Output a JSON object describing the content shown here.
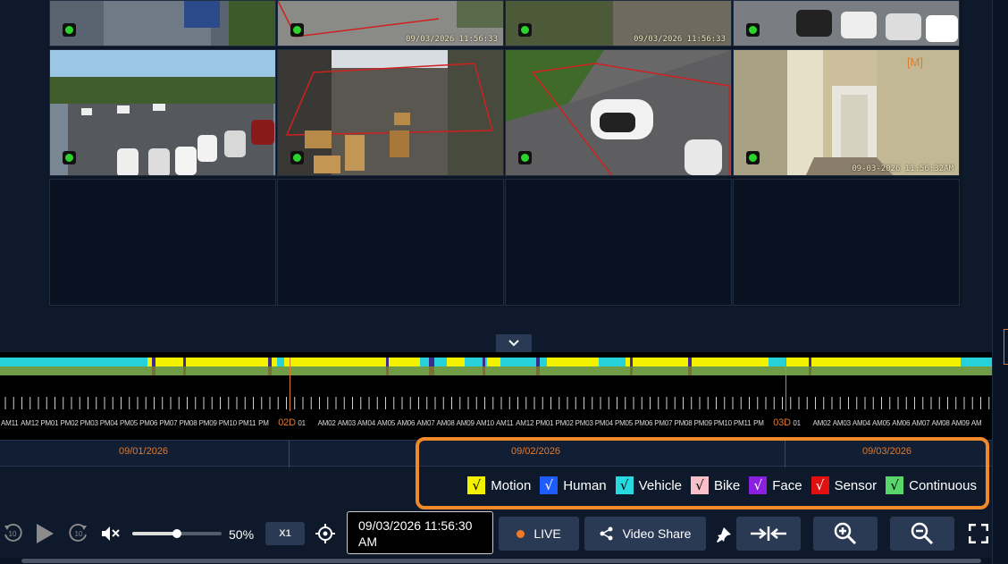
{
  "cameras": [
    {
      "id": "cam-1",
      "status": "online",
      "timestamp": ""
    },
    {
      "id": "cam-2",
      "status": "online",
      "timestamp": "09/03/2026 11:56:33"
    },
    {
      "id": "cam-3",
      "status": "online",
      "timestamp": "09/03/2026 11:56:33"
    },
    {
      "id": "cam-4",
      "status": "online",
      "timestamp": ""
    },
    {
      "id": "cam-5",
      "status": "online",
      "timestamp": ""
    },
    {
      "id": "cam-6",
      "status": "online",
      "timestamp": ""
    },
    {
      "id": "cam-7",
      "status": "online",
      "timestamp": ""
    },
    {
      "id": "cam-8",
      "status": "online",
      "timestamp": "09-03-2026 11:56:32AM",
      "mark": "[M]"
    }
  ],
  "timeline": {
    "hour_labels": [
      "AM11",
      "AM12",
      "PM01",
      "PM02",
      "PM03",
      "PM04",
      "PM05",
      "PM06",
      "PM07",
      "PM08",
      "PM09",
      "PM10",
      "PM11",
      "PM",
      "02D",
      "01",
      "AM02",
      "AM03",
      "AM04",
      "AM05",
      "AM06",
      "AM07",
      "AM08",
      "AM09",
      "AM10",
      "AM11",
      "AM12",
      "PM01",
      "PM02",
      "PM03",
      "PM04",
      "PM05",
      "PM06",
      "PM07",
      "PM08",
      "PM09",
      "PM10",
      "PM11",
      "PM",
      "03D",
      "01",
      "AM02",
      "AM03",
      "AM04",
      "AM05",
      "AM06",
      "AM07",
      "AM08",
      "AM09",
      "AM"
    ],
    "day_markers": [
      "02D",
      "03D"
    ],
    "dates": [
      "09/01/2026",
      "09/02/2026",
      "09/03/2026"
    ]
  },
  "legend": [
    {
      "label": "Motion",
      "color": "#f2f200"
    },
    {
      "label": "Human",
      "color": "#1f5cff"
    },
    {
      "label": "Vehicle",
      "color": "#27d9e0"
    },
    {
      "label": "Bike",
      "color": "#f8c0c8"
    },
    {
      "label": "Face",
      "color": "#8a1fe0"
    },
    {
      "label": "Sensor",
      "color": "#e01010"
    },
    {
      "label": "Continuous",
      "color": "#59d66a"
    }
  ],
  "legend_check": "√",
  "controls": {
    "rewind_label": "10",
    "forward_label": "10",
    "volume_percent": "50%",
    "volume_level": 0.5,
    "speed": "X1",
    "datetime": "09/03/2026 11:56:30 AM",
    "live_label": "LIVE",
    "share_label": "Video Share"
  }
}
